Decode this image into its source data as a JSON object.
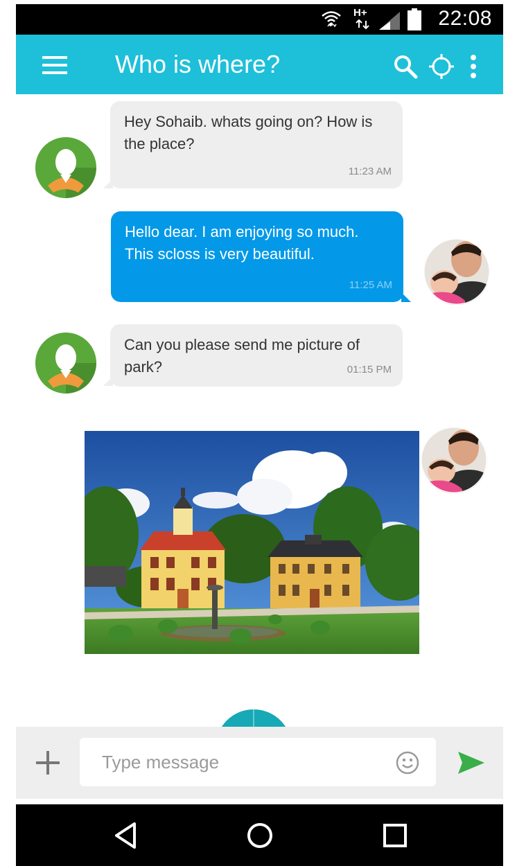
{
  "status_bar": {
    "time": "22:08",
    "network_label": "H+",
    "icons": [
      "wifi-icon",
      "network-type-icon",
      "signal-icon",
      "battery-icon"
    ]
  },
  "app_bar": {
    "title": "Who is where?",
    "icons": [
      "menu-icon",
      "search-icon",
      "locate-icon",
      "more-vert-icon"
    ],
    "color": "#1EBFD9"
  },
  "messages": [
    {
      "direction": "incoming",
      "text": "Hey Sohaib. whats going on? How is the place?",
      "time": "11:23 AM",
      "avatar": "default-avatar"
    },
    {
      "direction": "outgoing",
      "text": "Hello dear. I am enjoying so much. This scloss is very beautiful.",
      "time": "11:25 AM",
      "avatar": "father-baby-photo"
    },
    {
      "direction": "incoming",
      "text": "Can you please send me picture of park?",
      "time": "01:15 PM",
      "avatar": "default-avatar"
    },
    {
      "direction": "outgoing",
      "type": "image",
      "image": "castle-park-photo",
      "avatar": "father-baby-photo"
    }
  ],
  "composer": {
    "placeholder": "Type message",
    "icons": [
      "add-icon",
      "emoji-icon",
      "send-icon"
    ],
    "send_color": "#3AAE49"
  },
  "colors": {
    "outgoing_bubble": "#0399E8",
    "incoming_bubble": "#EEEEEE"
  },
  "nav_bar": {
    "icons": [
      "back-icon",
      "home-icon",
      "recents-icon"
    ]
  }
}
